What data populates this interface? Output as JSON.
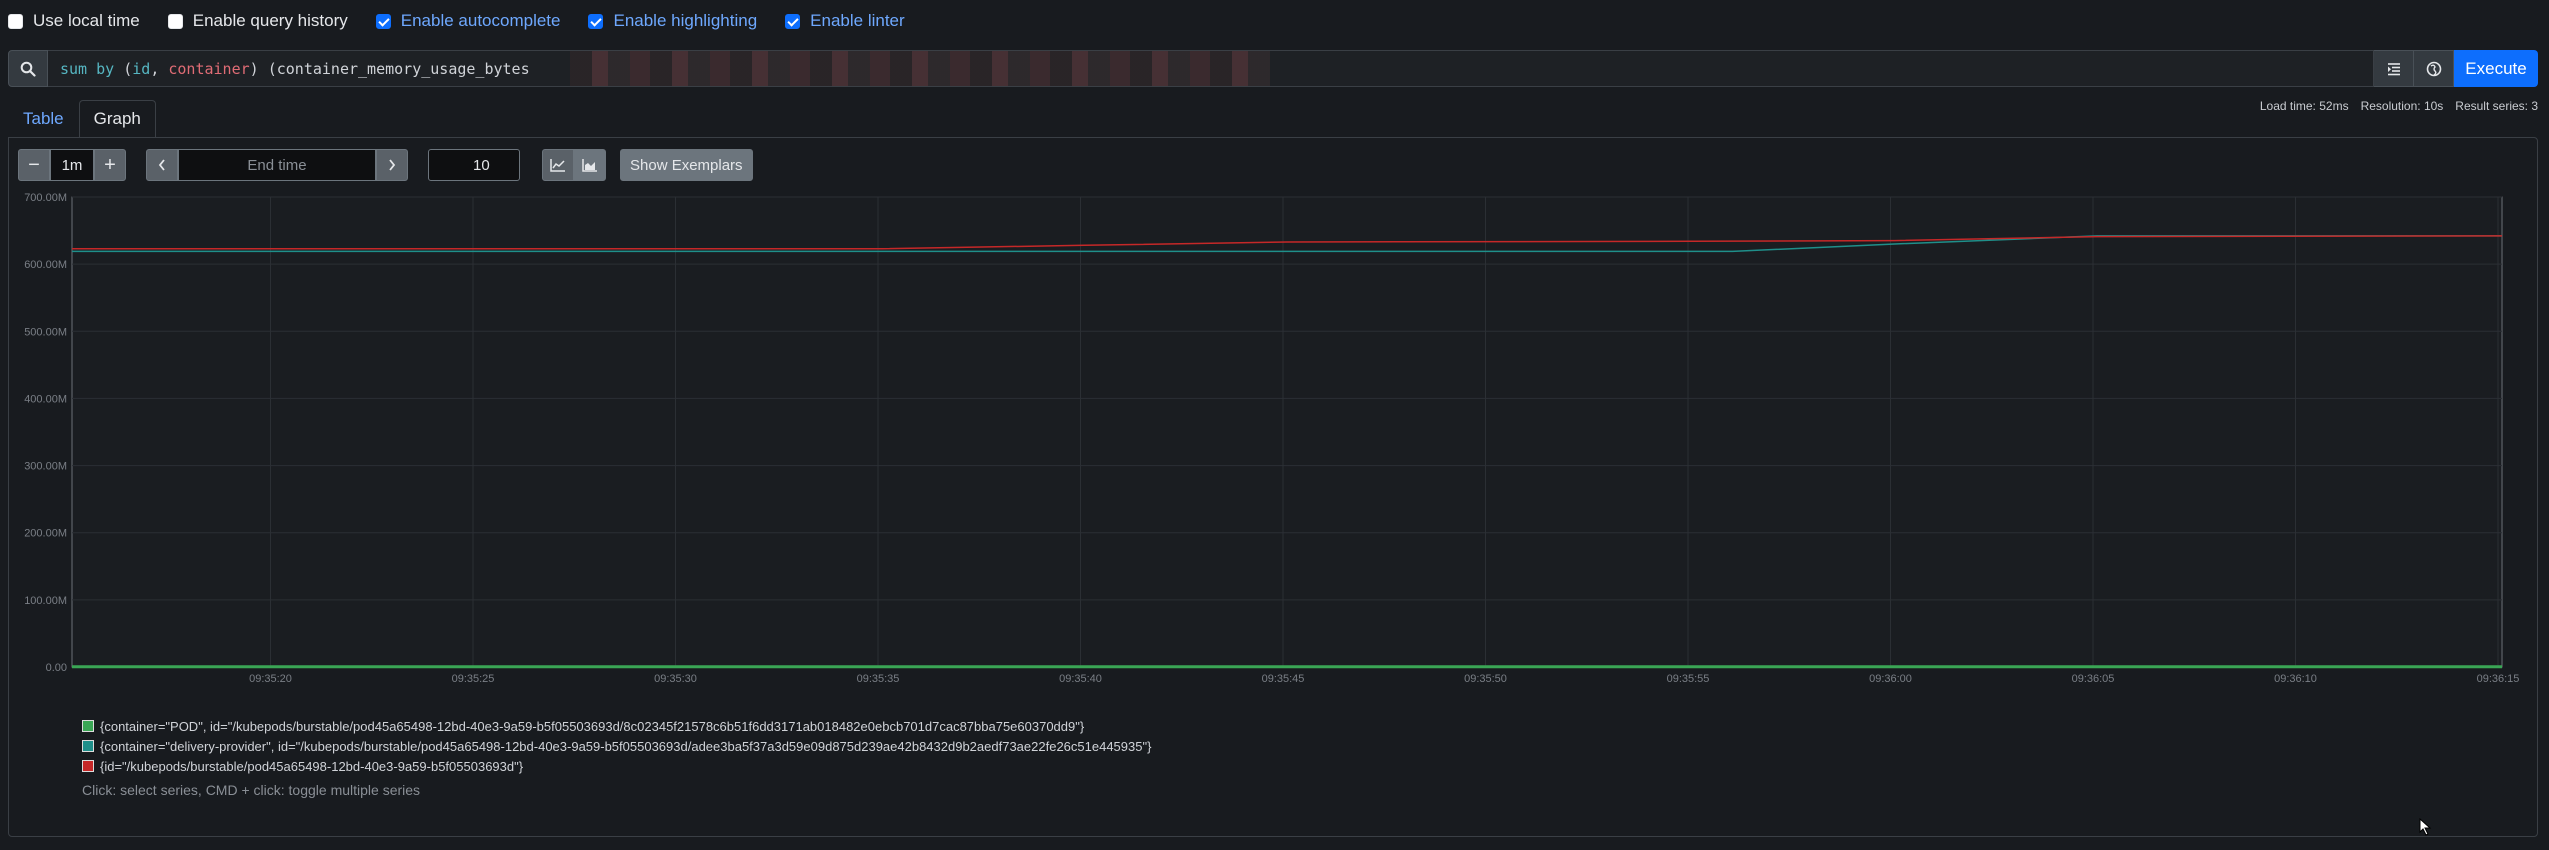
{
  "options": [
    {
      "label": "Use local time",
      "checked": false
    },
    {
      "label": "Enable query history",
      "checked": false
    },
    {
      "label": "Enable autocomplete",
      "checked": true
    },
    {
      "label": "Enable highlighting",
      "checked": true
    },
    {
      "label": "Enable linter",
      "checked": true
    }
  ],
  "query": {
    "fn": "sum by",
    "open": " (",
    "label1": "id",
    "comma": ", ",
    "label2": "container",
    "close": ") ",
    "rest": "(container_memory_usage_bytes"
  },
  "execute_label": "Execute",
  "tabs": [
    {
      "label": "Table",
      "active": false
    },
    {
      "label": "Graph",
      "active": true
    }
  ],
  "stats": {
    "load": "Load time: 52ms",
    "resolution": "Resolution: 10s",
    "series": "Result series: 3"
  },
  "controls": {
    "range": "1m",
    "end_time_placeholder": "End time",
    "resolution": "10",
    "exemplars_label": "Show Exemplars"
  },
  "chart_data": {
    "type": "line",
    "ylim": [
      0,
      700
    ],
    "y_ticks": [
      {
        "value": 700,
        "label": "700.00M"
      },
      {
        "value": 600,
        "label": "600.00M"
      },
      {
        "value": 500,
        "label": "500.00M"
      },
      {
        "value": 400,
        "label": "400.00M"
      },
      {
        "value": 300,
        "label": "300.00M"
      },
      {
        "value": 200,
        "label": "200.00M"
      },
      {
        "value": 100,
        "label": "100.00M"
      },
      {
        "value": 0,
        "label": "0.00"
      }
    ],
    "xlim": [
      "09:35:15",
      "09:36:15"
    ],
    "x_ticks": [
      "09:35:20",
      "09:35:25",
      "09:35:30",
      "09:35:35",
      "09:35:40",
      "09:35:45",
      "09:35:50",
      "09:35:55",
      "09:36:00",
      "09:36:05",
      "09:36:10",
      "09:36:15"
    ],
    "grid": true,
    "series": [
      {
        "name": "{container=\"POD\", id=\"/kubepods/burstable/pod45a65498-12bd-40e3-9a59-b5f05503693d/8c02345f21578c6b51f6dd3171ab018482e0ebcb701d7cac87bba75e60370dd9\"}",
        "color": "#3aa655",
        "x": [
          "09:35:15",
          "09:35:25",
          "09:35:35",
          "09:35:45",
          "09:35:55",
          "09:36:05",
          "09:36:15"
        ],
        "values": [
          0.5,
          0.5,
          0.5,
          0.5,
          0.5,
          0.5,
          0.5
        ]
      },
      {
        "name": "{container=\"delivery-provider\", id=\"/kubepods/burstable/pod45a65498-12bd-40e3-9a59-b5f05503693d/adee3ba5f37a3d59e09d875d239ae42b8432d9b2aedf73ae22fe26c51e445935\"}",
        "color": "#1f8f8a",
        "x": [
          "09:35:15",
          "09:35:25",
          "09:35:35",
          "09:35:45",
          "09:35:55",
          "09:35:56",
          "09:36:00",
          "09:36:05",
          "09:36:15"
        ],
        "values": [
          619,
          619,
          619,
          619,
          619,
          619,
          630,
          642,
          642
        ]
      },
      {
        "name": "{id=\"/kubepods/burstable/pod45a65498-12bd-40e3-9a59-b5f05503693d\"}",
        "color": "#c62828",
        "x": [
          "09:35:15",
          "09:35:25",
          "09:35:35",
          "09:35:40",
          "09:35:45",
          "09:35:55",
          "09:36:00",
          "09:36:05",
          "09:36:15"
        ],
        "values": [
          623,
          623,
          623,
          628,
          633,
          634,
          635,
          641,
          642
        ]
      }
    ]
  },
  "legend_hint": "Click: select series, CMD + click: toggle multiple series"
}
